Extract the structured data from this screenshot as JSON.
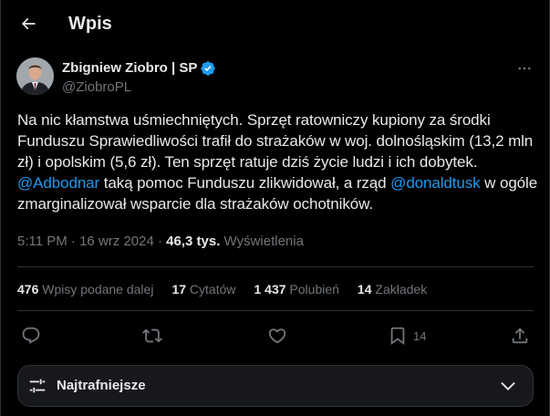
{
  "header": {
    "title": "Wpis"
  },
  "author": {
    "name": "Zbigniew Ziobro | SP",
    "handle": "@ZiobroPL",
    "verified": true
  },
  "tweet": {
    "text_part1": "Na nic kłamstwa uśmiechniętych. Sprzęt ratowniczy kupiony za środki Funduszu Sprawiedliwości trafił do strażaków w woj. dolnośląskim (13,2 mln zł) i opolskim (5,6 zł). Ten sprzęt ratuje dziś życie ludzi i ich dobytek. ",
    "mention1": "@Adbodnar",
    "text_part2": " taką pomoc Funduszu zlikwidował, a rząd ",
    "mention2": "@donaldtusk",
    "text_part3": " w ogóle zmarginalizował wsparcie dla strażaków ochotników."
  },
  "meta": {
    "time": "5:11 PM",
    "separator": " · ",
    "date": "16 wrz 2024",
    "views_count": "46,3 tys.",
    "views_label": " Wyświetlenia"
  },
  "stats": {
    "reposts_count": "476",
    "reposts_label": " Wpisy podane dalej",
    "quotes_count": "17",
    "quotes_label": " Cytatów",
    "likes_count": "1 437",
    "likes_label": " Polubień",
    "bookmarks_count": "14",
    "bookmarks_label": " Zakładek"
  },
  "actions": {
    "bookmark_count": "14"
  },
  "sort": {
    "label": "Najtrafniejsze"
  },
  "colors": {
    "background": "#000000",
    "text": "#e7e9ea",
    "secondary": "#71767b",
    "accent": "#1d9bf0",
    "divider": "#2f3336"
  },
  "icons": {
    "back": "arrow-left-icon",
    "verified": "verified-badge-icon",
    "more": "more-horizontal-icon",
    "reply": "reply-icon",
    "repost": "repost-icon",
    "like": "heart-icon",
    "bookmark": "bookmark-icon",
    "share": "share-icon",
    "sort": "sliders-icon",
    "chevron": "chevron-down-icon"
  }
}
